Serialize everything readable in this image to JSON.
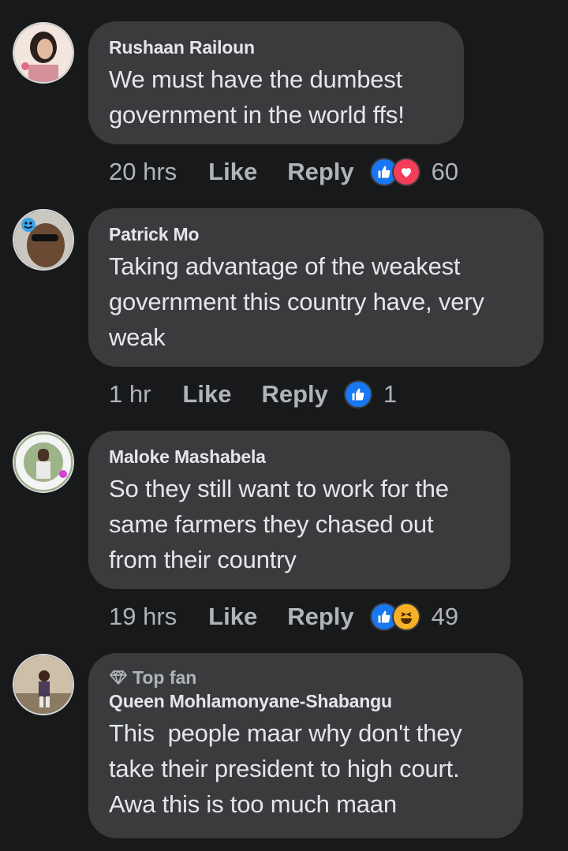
{
  "comments": [
    {
      "author": "Rushaan Railoun",
      "text_lines": [
        "We must have the dumbest",
        "government in the world ffs!"
      ],
      "time": "20 hrs",
      "like_label": "Like",
      "reply_label": "Reply",
      "reactions": [
        "like-icon",
        "love-icon"
      ],
      "reaction_count": "60",
      "avatar_color": "#c9a08a"
    },
    {
      "author": "Patrick Mo",
      "text_lines": [
        "Taking advantage of the weakest",
        "government this country have, very",
        "weak"
      ],
      "time": "1 hr",
      "like_label": "Like",
      "reply_label": "Reply",
      "reactions": [
        "like-icon"
      ],
      "reaction_count": "1",
      "avatar_color": "#6b4a34"
    },
    {
      "author": "Maloke Mashabela",
      "text_lines": [
        "So they still want to work for the",
        "same farmers they chased out",
        "from their country"
      ],
      "time": "19 hrs",
      "like_label": "Like",
      "reply_label": "Reply",
      "reactions": [
        "like-icon",
        "haha-icon"
      ],
      "reaction_count": "49",
      "avatar_color": "#7f9a6b"
    },
    {
      "badge": "Top fan",
      "author": "Queen Mohlamonyane-Shabangu",
      "text_lines": [
        "This  people maar why don't they",
        "take their president to high court.",
        "Awa this is too much maan"
      ],
      "avatar_color": "#a3845f"
    }
  ]
}
